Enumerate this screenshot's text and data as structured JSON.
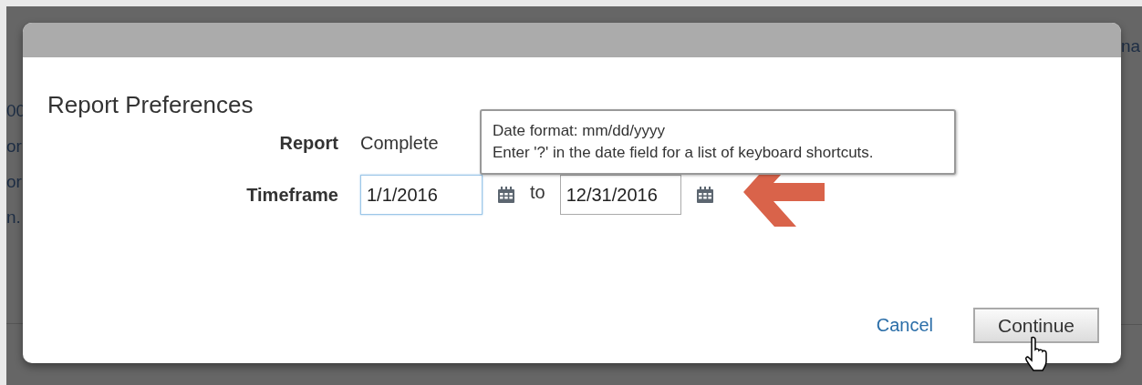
{
  "background": {
    "left_texts": [
      "00",
      "or",
      "or",
      "n."
    ],
    "right_text": "na"
  },
  "dialog": {
    "title": "Report Preferences",
    "report": {
      "label": "Report",
      "value": "Complete"
    },
    "timeframe": {
      "label": "Timeframe",
      "connector": "to",
      "dates": [
        {
          "value": "1/1/2016",
          "focused": true
        },
        {
          "value": "12/31/2016",
          "focused": false
        }
      ]
    },
    "tooltip": {
      "lines": [
        "Date format: mm/dd/yyyy",
        "Enter '?' in the date field for a list of keyboard shortcuts."
      ]
    },
    "buttons": [
      {
        "label": "Cancel",
        "kind": "link"
      },
      {
        "label": "Continue",
        "kind": "button"
      }
    ]
  }
}
